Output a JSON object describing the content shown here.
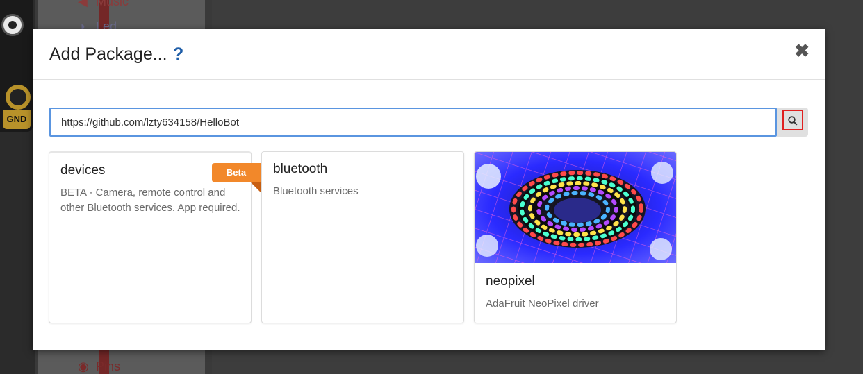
{
  "background": {
    "simulator_pin_label": "GND",
    "toolbox_items": [
      {
        "label": "Music",
        "icon": "headphones-icon"
      },
      {
        "label": "Led",
        "icon": "toggle-icon"
      },
      {
        "label": "Pins",
        "icon": "circle-dot-icon"
      }
    ]
  },
  "dialog": {
    "title": "Add Package...",
    "help_label": "?",
    "close_label": "✖",
    "search": {
      "value": "https://github.com/lzty634158/HelloBot",
      "button_icon": "search-icon"
    },
    "cards": [
      {
        "title": "devices",
        "description": "BETA - Camera, remote control and other Bluetooth services. App required.",
        "badge": "Beta"
      },
      {
        "title": "bluetooth",
        "description": "Bluetooth services"
      },
      {
        "title": "neopixel",
        "description": "AdaFruit NeoPixel driver",
        "image": "neopixel-led-strip-image"
      }
    ]
  },
  "colors": {
    "accent_blue": "#1f5ea8",
    "input_border": "#5a95e0",
    "beta_orange": "#f2882a",
    "highlight_red": "#e02020"
  }
}
